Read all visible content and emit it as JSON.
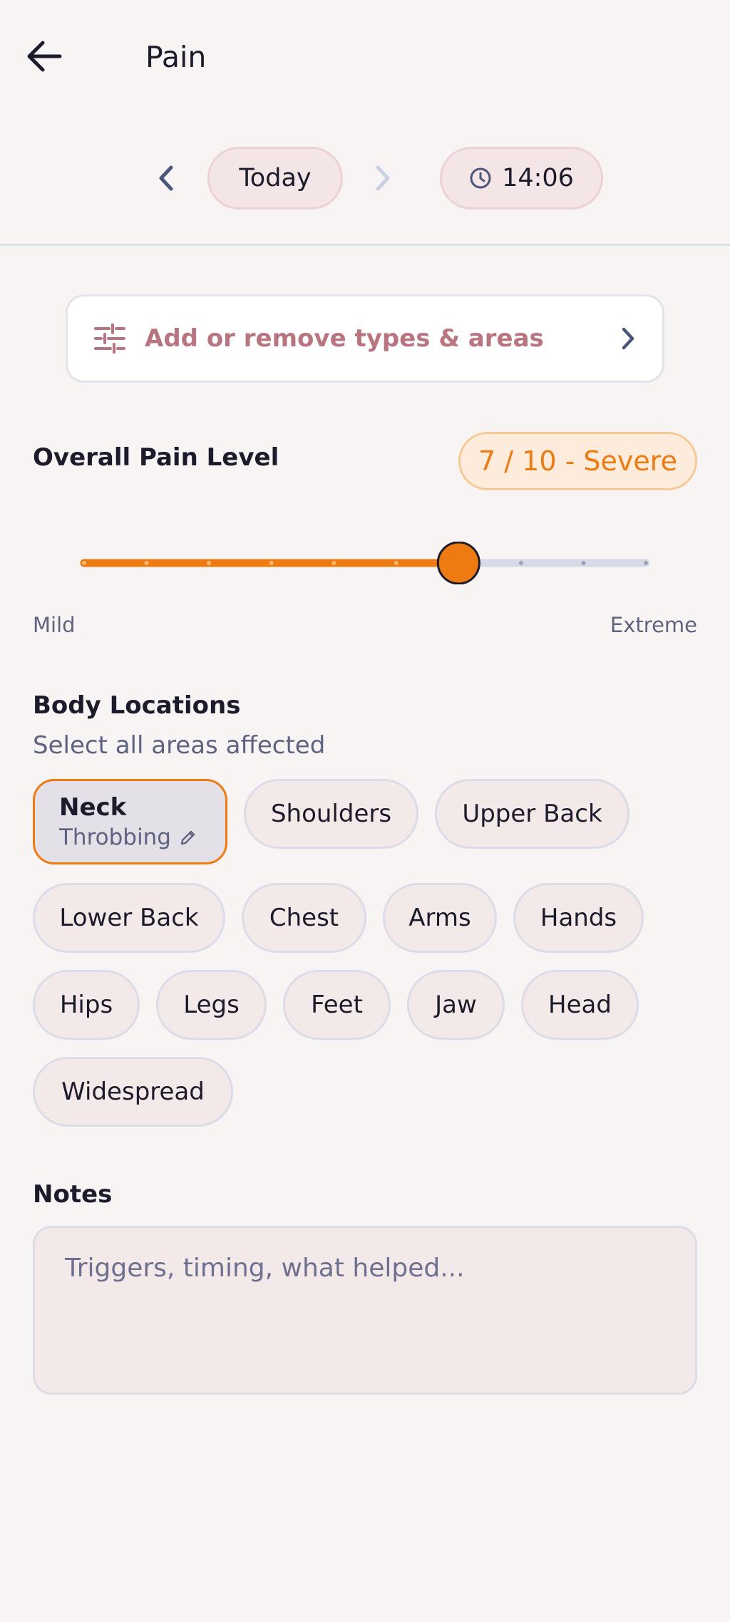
{
  "header": {
    "title": "Pain",
    "back_icon": "arrow-left-icon"
  },
  "date_nav": {
    "prev_icon": "chevron-left-icon",
    "date_label": "Today",
    "next_icon": "chevron-right-icon",
    "next_enabled": false,
    "time_icon": "clock-icon",
    "time_label": "14:06"
  },
  "types_card": {
    "icon": "sliders-icon",
    "label": "Add or remove types & areas",
    "chevron_icon": "chevron-right-icon"
  },
  "pain_level": {
    "title": "Overall Pain Level",
    "badge": "7 / 10 - Severe",
    "value": 7,
    "max": 10,
    "min_label": "Mild",
    "max_label": "Extreme",
    "accent": "#ee7a12"
  },
  "body_locations": {
    "title": "Body Locations",
    "subtitle": "Select all areas affected",
    "selected": {
      "label": "Neck",
      "detail": "Throbbing",
      "edit_icon": "pencil-icon"
    },
    "chips": [
      "Shoulders",
      "Upper Back",
      "Lower Back",
      "Chest",
      "Arms",
      "Hands",
      "Hips",
      "Legs",
      "Feet",
      "Jaw",
      "Head",
      "Widespread"
    ]
  },
  "notes": {
    "title": "Notes",
    "placeholder": "Triggers, timing, what helped...",
    "value": ""
  }
}
